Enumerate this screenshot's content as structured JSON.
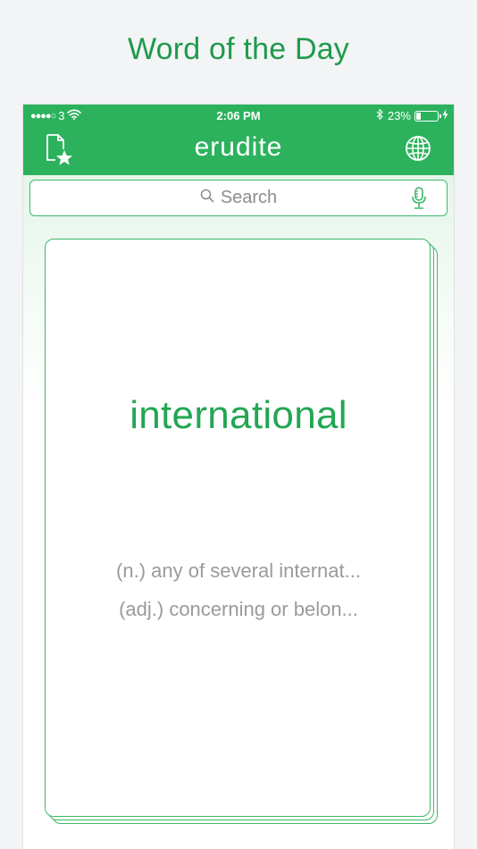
{
  "headline": "Word of the Day",
  "status_bar": {
    "signal": "●●●●○",
    "carrier": "3",
    "time": "2:06 PM",
    "battery_percent": "23%",
    "battery_level": 0.23
  },
  "navbar": {
    "title": "erudite",
    "left_icon": "favorites-document-star-icon",
    "right_icon": "globe-icon"
  },
  "search": {
    "placeholder": "Search",
    "icon": "search-icon",
    "mic_icon": "microphone-icon"
  },
  "card": {
    "word": "international",
    "definitions": [
      "(n.) any of several internat...",
      "(adj.) concerning or belon..."
    ]
  },
  "colors": {
    "brand_green": "#2cb25d",
    "word_green": "#23a653",
    "definition_gray": "#9a9a9a"
  }
}
